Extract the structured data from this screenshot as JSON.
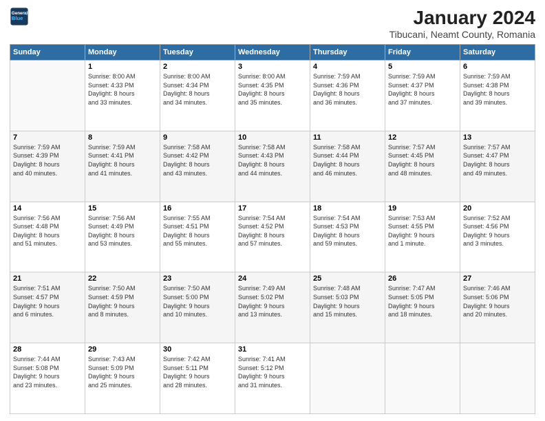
{
  "logo": {
    "line1": "General",
    "line2": "Blue"
  },
  "title": "January 2024",
  "subtitle": "Tibucani, Neamt County, Romania",
  "header_color": "#2e6da4",
  "days_of_week": [
    "Sunday",
    "Monday",
    "Tuesday",
    "Wednesday",
    "Thursday",
    "Friday",
    "Saturday"
  ],
  "weeks": [
    [
      {
        "day": "",
        "text": ""
      },
      {
        "day": "1",
        "text": "Sunrise: 8:00 AM\nSunset: 4:33 PM\nDaylight: 8 hours\nand 33 minutes."
      },
      {
        "day": "2",
        "text": "Sunrise: 8:00 AM\nSunset: 4:34 PM\nDaylight: 8 hours\nand 34 minutes."
      },
      {
        "day": "3",
        "text": "Sunrise: 8:00 AM\nSunset: 4:35 PM\nDaylight: 8 hours\nand 35 minutes."
      },
      {
        "day": "4",
        "text": "Sunrise: 7:59 AM\nSunset: 4:36 PM\nDaylight: 8 hours\nand 36 minutes."
      },
      {
        "day": "5",
        "text": "Sunrise: 7:59 AM\nSunset: 4:37 PM\nDaylight: 8 hours\nand 37 minutes."
      },
      {
        "day": "6",
        "text": "Sunrise: 7:59 AM\nSunset: 4:38 PM\nDaylight: 8 hours\nand 39 minutes."
      }
    ],
    [
      {
        "day": "7",
        "text": "Sunrise: 7:59 AM\nSunset: 4:39 PM\nDaylight: 8 hours\nand 40 minutes."
      },
      {
        "day": "8",
        "text": "Sunrise: 7:59 AM\nSunset: 4:41 PM\nDaylight: 8 hours\nand 41 minutes."
      },
      {
        "day": "9",
        "text": "Sunrise: 7:58 AM\nSunset: 4:42 PM\nDaylight: 8 hours\nand 43 minutes."
      },
      {
        "day": "10",
        "text": "Sunrise: 7:58 AM\nSunset: 4:43 PM\nDaylight: 8 hours\nand 44 minutes."
      },
      {
        "day": "11",
        "text": "Sunrise: 7:58 AM\nSunset: 4:44 PM\nDaylight: 8 hours\nand 46 minutes."
      },
      {
        "day": "12",
        "text": "Sunrise: 7:57 AM\nSunset: 4:45 PM\nDaylight: 8 hours\nand 48 minutes."
      },
      {
        "day": "13",
        "text": "Sunrise: 7:57 AM\nSunset: 4:47 PM\nDaylight: 8 hours\nand 49 minutes."
      }
    ],
    [
      {
        "day": "14",
        "text": "Sunrise: 7:56 AM\nSunset: 4:48 PM\nDaylight: 8 hours\nand 51 minutes."
      },
      {
        "day": "15",
        "text": "Sunrise: 7:56 AM\nSunset: 4:49 PM\nDaylight: 8 hours\nand 53 minutes."
      },
      {
        "day": "16",
        "text": "Sunrise: 7:55 AM\nSunset: 4:51 PM\nDaylight: 8 hours\nand 55 minutes."
      },
      {
        "day": "17",
        "text": "Sunrise: 7:54 AM\nSunset: 4:52 PM\nDaylight: 8 hours\nand 57 minutes."
      },
      {
        "day": "18",
        "text": "Sunrise: 7:54 AM\nSunset: 4:53 PM\nDaylight: 8 hours\nand 59 minutes."
      },
      {
        "day": "19",
        "text": "Sunrise: 7:53 AM\nSunset: 4:55 PM\nDaylight: 9 hours\nand 1 minute."
      },
      {
        "day": "20",
        "text": "Sunrise: 7:52 AM\nSunset: 4:56 PM\nDaylight: 9 hours\nand 3 minutes."
      }
    ],
    [
      {
        "day": "21",
        "text": "Sunrise: 7:51 AM\nSunset: 4:57 PM\nDaylight: 9 hours\nand 6 minutes."
      },
      {
        "day": "22",
        "text": "Sunrise: 7:50 AM\nSunset: 4:59 PM\nDaylight: 9 hours\nand 8 minutes."
      },
      {
        "day": "23",
        "text": "Sunrise: 7:50 AM\nSunset: 5:00 PM\nDaylight: 9 hours\nand 10 minutes."
      },
      {
        "day": "24",
        "text": "Sunrise: 7:49 AM\nSunset: 5:02 PM\nDaylight: 9 hours\nand 13 minutes."
      },
      {
        "day": "25",
        "text": "Sunrise: 7:48 AM\nSunset: 5:03 PM\nDaylight: 9 hours\nand 15 minutes."
      },
      {
        "day": "26",
        "text": "Sunrise: 7:47 AM\nSunset: 5:05 PM\nDaylight: 9 hours\nand 18 minutes."
      },
      {
        "day": "27",
        "text": "Sunrise: 7:46 AM\nSunset: 5:06 PM\nDaylight: 9 hours\nand 20 minutes."
      }
    ],
    [
      {
        "day": "28",
        "text": "Sunrise: 7:44 AM\nSunset: 5:08 PM\nDaylight: 9 hours\nand 23 minutes."
      },
      {
        "day": "29",
        "text": "Sunrise: 7:43 AM\nSunset: 5:09 PM\nDaylight: 9 hours\nand 25 minutes."
      },
      {
        "day": "30",
        "text": "Sunrise: 7:42 AM\nSunset: 5:11 PM\nDaylight: 9 hours\nand 28 minutes."
      },
      {
        "day": "31",
        "text": "Sunrise: 7:41 AM\nSunset: 5:12 PM\nDaylight: 9 hours\nand 31 minutes."
      },
      {
        "day": "",
        "text": ""
      },
      {
        "day": "",
        "text": ""
      },
      {
        "day": "",
        "text": ""
      }
    ]
  ]
}
